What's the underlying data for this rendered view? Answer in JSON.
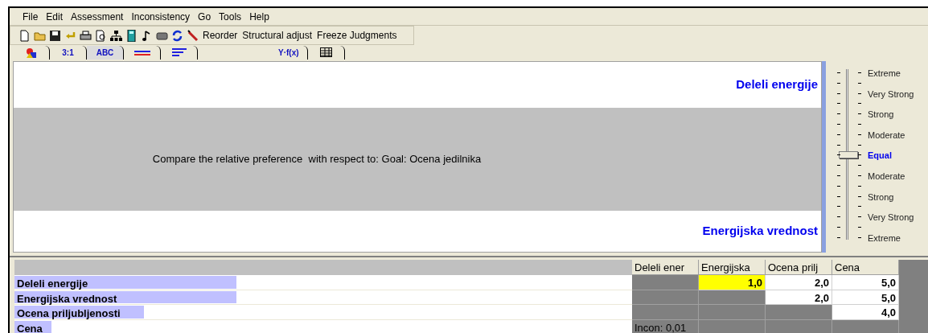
{
  "menu": [
    "File",
    "Edit",
    "Assessment",
    "Inconsistency",
    "Go",
    "Tools",
    "Help"
  ],
  "toolbar": {
    "buttons": [
      "Reorder",
      "Structural adjust",
      "Freeze Judgments"
    ]
  },
  "tabs": [
    {
      "kind": "icon",
      "selected": false
    },
    {
      "kind": "text",
      "label": "3:1",
      "selected": false
    },
    {
      "kind": "text",
      "label": "ABC",
      "selected": true
    },
    {
      "kind": "icon",
      "selected": false
    },
    {
      "kind": "icon",
      "selected": false
    },
    {
      "kind": "gap"
    },
    {
      "kind": "text",
      "label": "Y·f(x)",
      "selected": false
    },
    {
      "kind": "icon",
      "selected": false
    }
  ],
  "comparison": {
    "top_element": "Deleli energije",
    "prompt": "Compare the relative preference  with respect to: Goal: Ocena jedilnika",
    "bottom_element": "Energijska vrednost"
  },
  "scale": {
    "level": 0.5,
    "labels": [
      {
        "text": "Extreme",
        "selected": false
      },
      {
        "text": "Very Strong",
        "selected": false
      },
      {
        "text": "Strong",
        "selected": false
      },
      {
        "text": "Moderate",
        "selected": false
      },
      {
        "text": "Equal",
        "selected": true
      },
      {
        "text": "Moderate",
        "selected": false
      },
      {
        "text": "Strong",
        "selected": false
      },
      {
        "text": "Very Strong",
        "selected": false
      },
      {
        "text": "Extreme",
        "selected": false
      }
    ]
  },
  "matrix": {
    "columns": [
      "Deleli ener",
      "Energijska",
      "Ocena prilj",
      "Cena"
    ],
    "rows": [
      {
        "label": "Deleli energije",
        "level": 0.36,
        "cells": [
          {
            "kind": "blank"
          },
          {
            "kind": "value",
            "text": "1,0",
            "selected": true
          },
          {
            "kind": "value",
            "text": "2,0",
            "selected": false
          },
          {
            "kind": "value",
            "text": "5,0",
            "selected": false
          }
        ]
      },
      {
        "label": "Energijska vrednost",
        "level": 0.36,
        "cells": [
          {
            "kind": "blank"
          },
          {
            "kind": "blank"
          },
          {
            "kind": "value",
            "text": "2,0",
            "selected": false
          },
          {
            "kind": "value",
            "text": "5,0",
            "selected": false
          }
        ]
      },
      {
        "label": "Ocena priljubljenosti",
        "level": 0.21,
        "cells": [
          {
            "kind": "blank"
          },
          {
            "kind": "blank"
          },
          {
            "kind": "blank"
          },
          {
            "kind": "value",
            "text": "4,0",
            "selected": false
          }
        ]
      },
      {
        "label": "Cena",
        "level": 0.06,
        "cells": [
          {
            "kind": "note",
            "text": "Incon: 0,01"
          },
          {
            "kind": "blank"
          },
          {
            "kind": "blank"
          },
          {
            "kind": "blank"
          }
        ]
      }
    ]
  }
}
